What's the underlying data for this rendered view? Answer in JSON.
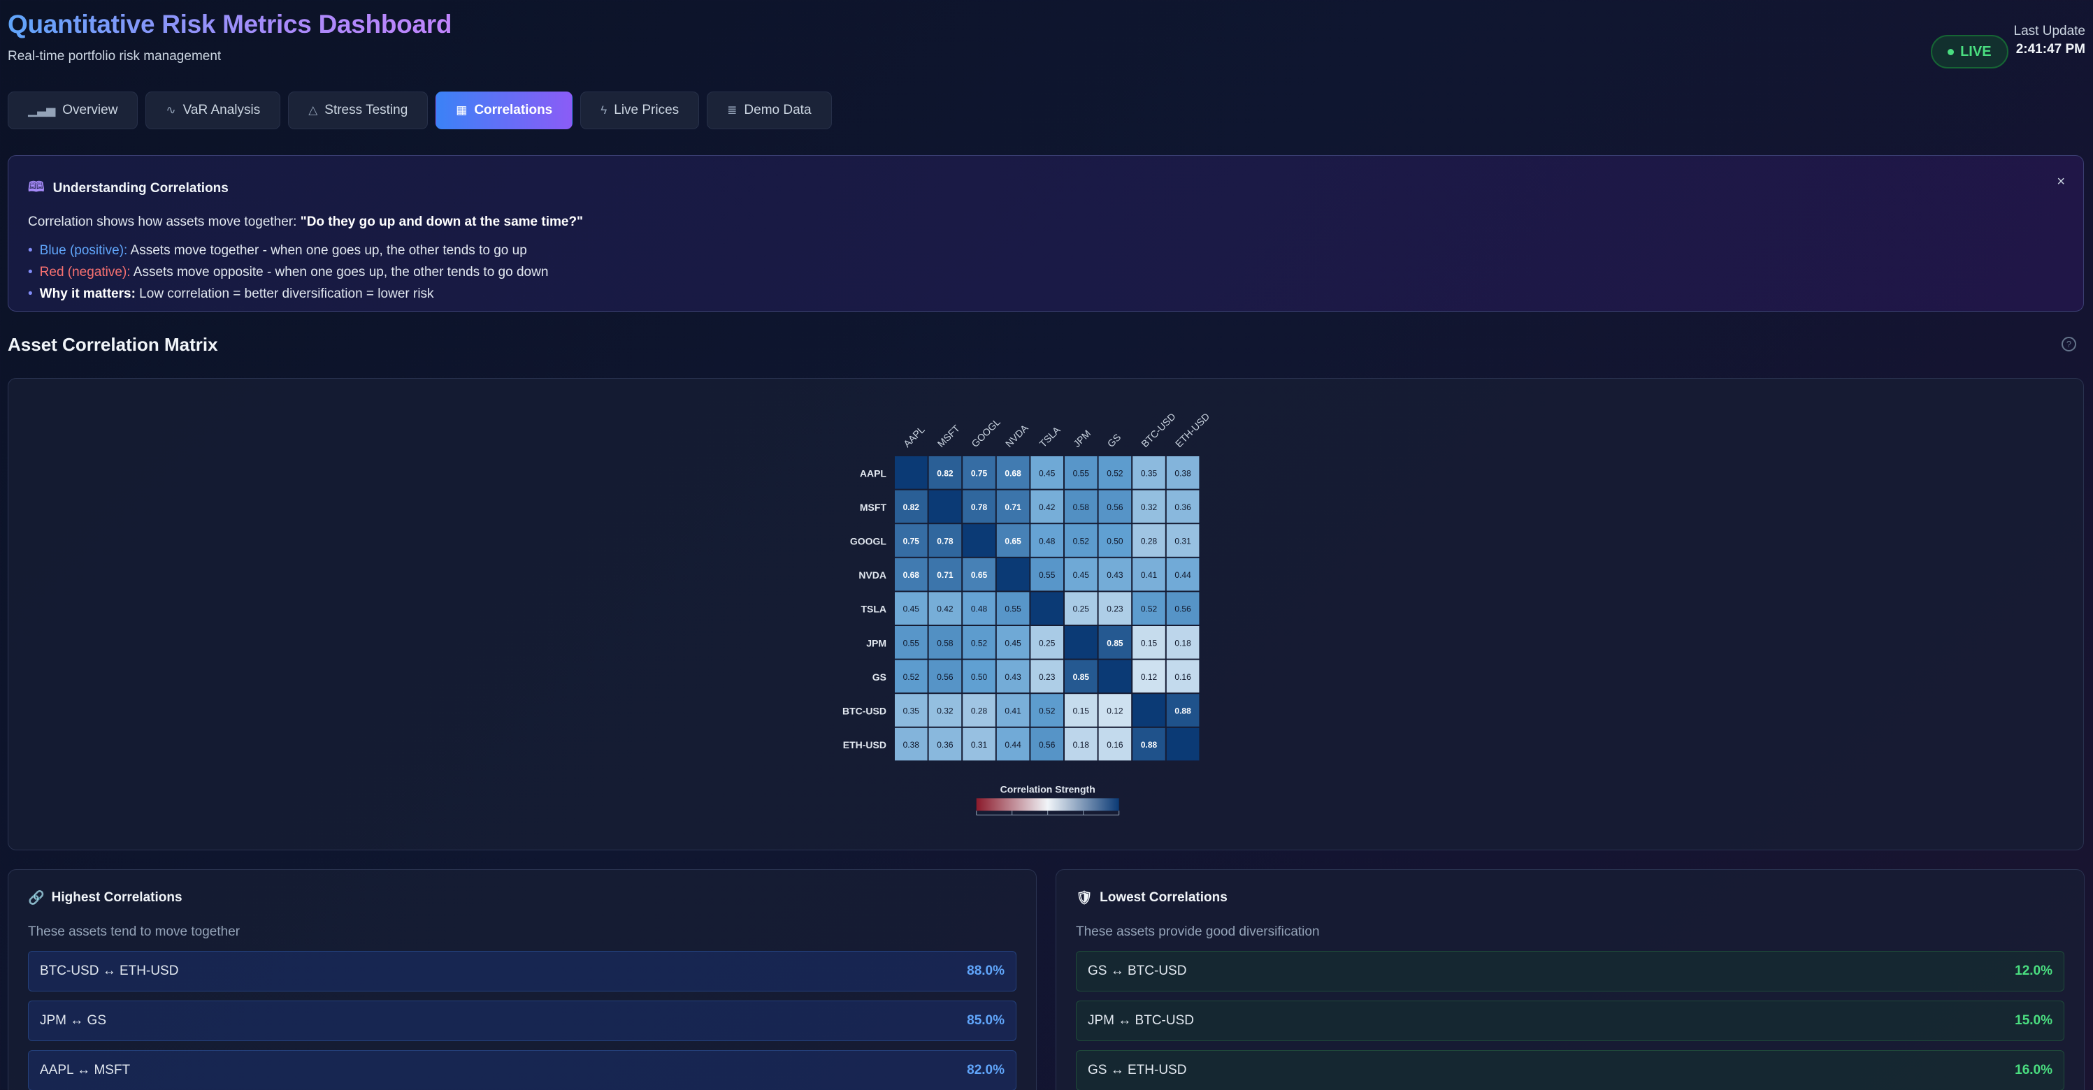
{
  "header": {
    "title": "Quantitative Risk Metrics Dashboard",
    "subtitle": "Real-time portfolio risk management",
    "live_label": "LIVE",
    "last_update_label": "Last Update",
    "last_update_time": "2:41:47 PM"
  },
  "tabs": [
    {
      "label": "Overview",
      "icon": "bar-chart-icon",
      "active": false
    },
    {
      "label": "VaR Analysis",
      "icon": "activity-icon",
      "active": false
    },
    {
      "label": "Stress Testing",
      "icon": "warning-icon",
      "active": false
    },
    {
      "label": "Correlations",
      "icon": "grid-icon",
      "active": true
    },
    {
      "label": "Live Prices",
      "icon": "lightning-icon",
      "active": false
    },
    {
      "label": "Demo Data",
      "icon": "database-icon",
      "active": false
    }
  ],
  "info": {
    "title": "Understanding Correlations",
    "close": "×",
    "lead_prefix": "Correlation shows how assets move together: ",
    "lead_quote": "\"Do they go up and down at the same time?\"",
    "items": [
      {
        "key": "Blue (positive):",
        "text": " Assets move together - when one goes up, the other tends to go up"
      },
      {
        "key": "Red (negative):",
        "text": " Assets move opposite - when one goes up, the other tends to go down"
      },
      {
        "key": "Why it matters:",
        "text": " Low correlation = better diversification = lower risk"
      }
    ]
  },
  "matrix_section": {
    "title": "Asset Correlation Matrix",
    "help": "?"
  },
  "chart_data": {
    "type": "heatmap",
    "title": "Correlation Strength",
    "labels": [
      "AAPL",
      "MSFT",
      "GOOGL",
      "NVDA",
      "TSLA",
      "JPM",
      "GS",
      "BTC-USD",
      "ETH-USD"
    ],
    "values": [
      [
        1.0,
        0.82,
        0.75,
        0.68,
        0.45,
        0.55,
        0.52,
        0.35,
        0.38
      ],
      [
        0.82,
        1.0,
        0.78,
        0.71,
        0.42,
        0.58,
        0.56,
        0.32,
        0.36
      ],
      [
        0.75,
        0.78,
        1.0,
        0.65,
        0.48,
        0.52,
        0.5,
        0.28,
        0.31
      ],
      [
        0.68,
        0.71,
        0.65,
        1.0,
        0.55,
        0.45,
        0.43,
        0.41,
        0.44
      ],
      [
        0.45,
        0.42,
        0.48,
        0.55,
        1.0,
        0.25,
        0.23,
        0.52,
        0.56
      ],
      [
        0.55,
        0.58,
        0.52,
        0.45,
        0.25,
        1.0,
        0.85,
        0.15,
        0.18
      ],
      [
        0.52,
        0.56,
        0.5,
        0.43,
        0.23,
        0.85,
        1.0,
        0.12,
        0.16
      ],
      [
        0.35,
        0.32,
        0.28,
        0.41,
        0.52,
        0.15,
        0.12,
        1.0,
        0.88
      ],
      [
        0.38,
        0.36,
        0.31,
        0.44,
        0.56,
        0.18,
        0.16,
        0.88,
        1.0
      ]
    ],
    "diagonal_label_shown": false,
    "color_scale": {
      "min": -1,
      "max": 1,
      "negative": "#8b1a2b",
      "neutral": "#f1f5f9",
      "positive": "#0b3a75"
    }
  },
  "highest": {
    "icon": "link-icon",
    "title": "Highest Correlations",
    "subtitle": "These assets tend to move together",
    "items": [
      {
        "pair": "BTC-USD ↔ ETH-USD",
        "value": "88.0%"
      },
      {
        "pair": "JPM ↔ GS",
        "value": "85.0%"
      },
      {
        "pair": "AAPL ↔ MSFT",
        "value": "82.0%"
      }
    ]
  },
  "lowest": {
    "icon": "shield-icon",
    "title": "Lowest Correlations",
    "subtitle": "These assets provide good diversification",
    "items": [
      {
        "pair": "GS ↔ BTC-USD",
        "value": "12.0%"
      },
      {
        "pair": "JPM ↔ BTC-USD",
        "value": "15.0%"
      },
      {
        "pair": "GS ↔ ETH-USD",
        "value": "16.0%"
      }
    ]
  },
  "colors": {
    "accent_blue": "#3b82f6",
    "accent_purple": "#8b5cf6",
    "live_green": "#4ade80",
    "high_value_blue": "#60a5fa",
    "low_value_green": "#4ade80"
  }
}
